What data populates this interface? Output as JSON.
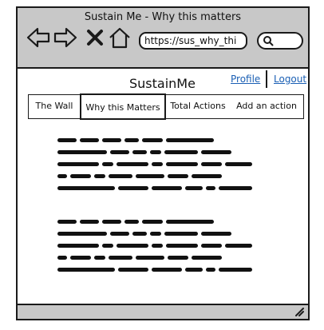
{
  "window": {
    "title": "Sustain Me - Why this matters"
  },
  "browser": {
    "back_icon": "arrow-left-icon",
    "forward_icon": "arrow-right-icon",
    "stop_icon": "close-icon",
    "home_icon": "home-icon",
    "url": "https://sus_why_thi",
    "search_icon": "search-icon"
  },
  "header": {
    "brand": "SustainMe",
    "profile_link": "Profile",
    "logout_link": "Logout"
  },
  "tabs": [
    {
      "label": "The Wall"
    },
    {
      "label": "Why this Matters",
      "selected": true
    },
    {
      "label": "Total Actions"
    },
    {
      "label": "Add an action"
    }
  ],
  "colors": {
    "chrome": "#c8c8c8",
    "link": "#1a5fb4",
    "border": "#1a1a1a"
  }
}
